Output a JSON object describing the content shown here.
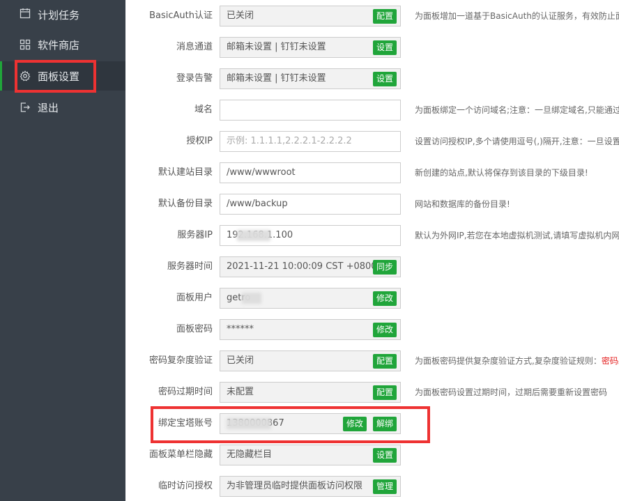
{
  "sidebar": {
    "items": [
      {
        "label": "计划任务",
        "icon": "calendar-icon"
      },
      {
        "label": "软件商店",
        "icon": "grid-icon"
      },
      {
        "label": "面板设置",
        "icon": "gear-icon",
        "active": true
      },
      {
        "label": "退出",
        "icon": "logout-icon"
      }
    ]
  },
  "settings": {
    "basicauth": {
      "label": "BasicAuth认证",
      "value": "已关闭",
      "button": "配置",
      "hint": "为面板增加一道基于BasicAuth的认证服务，有效防止面"
    },
    "message_channel": {
      "label": "消息通道",
      "value": "邮箱未设置 | 钉钉未设置",
      "button": "设置"
    },
    "login_alert": {
      "label": "登录告警",
      "value": "邮箱未设置 | 钉钉未设置",
      "button": "设置"
    },
    "domain": {
      "label": "域名",
      "value": "",
      "hint": "为面板绑定一个访问域名;注意：一旦绑定域名,只能通过"
    },
    "auth_ip": {
      "label": "授权IP",
      "placeholder": "示例: 1.1.1.1,2.2.2.1-2.2.2.2",
      "hint": "设置访问授权IP,多个请使用逗号(,)隔开,注意：一旦设置授"
    },
    "site_dir": {
      "label": "默认建站目录",
      "value": "/www/wwwroot",
      "hint": "新创建的站点,默认将保存到该目录的下级目录!"
    },
    "backup_dir": {
      "label": "默认备份目录",
      "value": "/www/backup",
      "hint": "网站和数据库的备份目录!"
    },
    "server_ip": {
      "label": "服务器IP",
      "value": "192.168.1.100",
      "hint": "默认为外网IP,若您在本地虚拟机测试,请填写虚拟机内网I"
    },
    "server_time": {
      "label": "服务器时间",
      "value": "2021-11-21 10:00:09 CST +0800",
      "button": "同步"
    },
    "panel_user": {
      "label": "面板用户",
      "value": "getro",
      "button": "修改"
    },
    "panel_password": {
      "label": "面板密码",
      "value": "******",
      "button": "修改"
    },
    "password_complexity": {
      "label": "密码复杂度验证",
      "value": "已关闭",
      "button": "配置",
      "hint": "为面板密码提供复杂度验证方式,复杂度验证规则：",
      "hint_red": "密码必"
    },
    "password_expiry": {
      "label": "密码过期时间",
      "value": "未配置",
      "button": "配置",
      "hint": "为面板密码设置过期时间，过期后需要重新设置密码"
    },
    "bt_account": {
      "label": "绑定宝塔账号",
      "value": "1380000867",
      "button_edit": "修改",
      "button_unbind": "解绑"
    },
    "menu_hide": {
      "label": "面板菜单栏隐藏",
      "value": "无隐藏栏目",
      "button": "设置"
    },
    "temp_access": {
      "label": "临时访问授权",
      "value": "为非管理员临时提供面板访问权限",
      "button": "管理"
    }
  },
  "colors": {
    "accent": "#20a53a",
    "sidebar_bg": "#384049",
    "highlight": "#ee3232"
  }
}
